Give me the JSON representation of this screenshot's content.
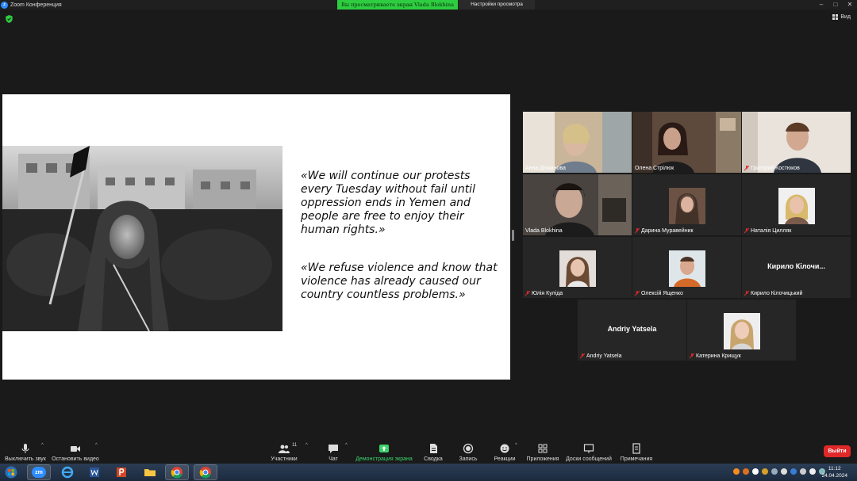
{
  "titlebar": {
    "app_title": "Zoom Конференция"
  },
  "share_banner": "Вы просматриваете экран Vlada Blokhina",
  "view_options": "Настройки просмотра",
  "view_button": "Вид",
  "slide": {
    "quote1": "«We will continue our protests every Tuesday without fail until oppression ends in Yemen and people are free to enjoy their human rights.»",
    "quote2": "«We refuse violence and know that violence has already caused our country countless problems.»"
  },
  "participants": [
    {
      "name": "Анна Доманова",
      "muted": false,
      "video": true
    },
    {
      "name": "Олена Стрілюк",
      "muted": false,
      "video": true
    },
    {
      "name": "Григорий Костюков",
      "muted": true,
      "video": true
    },
    {
      "name": "Vlada Blokhina",
      "muted": false,
      "video": true,
      "active_speaker": true
    },
    {
      "name": "Дарина Муравейник",
      "muted": true,
      "video": false
    },
    {
      "name": "Наталія Цилляк",
      "muted": true,
      "video": false
    },
    {
      "name": "Юлія Куліда",
      "muted": true,
      "video": false
    },
    {
      "name": "Олексій Ященко",
      "muted": true,
      "video": false
    },
    {
      "name": "Кирило Кілочицький",
      "muted": true,
      "video": false,
      "display_label": "Кирило Кілочи..."
    },
    {
      "name": "Andriy Yatsela",
      "muted": true,
      "video": false,
      "display_label": "Andriy Yatsela"
    },
    {
      "name": "Катерина Крищук",
      "muted": true,
      "video": false
    }
  ],
  "toolbar": {
    "mute": "Выключить звук",
    "stop_video": "Остановить видео",
    "participants": "Участники",
    "participants_count": "11",
    "chat": "Чат",
    "share_screen": "Демонстрация экрана",
    "summary": "Сводка",
    "record": "Запись",
    "reactions": "Реакции",
    "apps": "Приложения",
    "whiteboards": "Доски сообщений",
    "notes": "Примечания",
    "leave": "Выйти"
  },
  "taskbar": {
    "apps": [
      "start-orb",
      "zoom",
      "internet-explorer",
      "word",
      "powerpoint",
      "file-explorer",
      "chrome",
      "chrome"
    ],
    "zoom_label": "zm",
    "time": "11:12",
    "date": "24.04.2024"
  },
  "colors": {
    "accent_green": "#2ecc40",
    "leave_red": "#e02828",
    "active_speaker": "#c9e24a",
    "muted_red": "#e02828"
  }
}
